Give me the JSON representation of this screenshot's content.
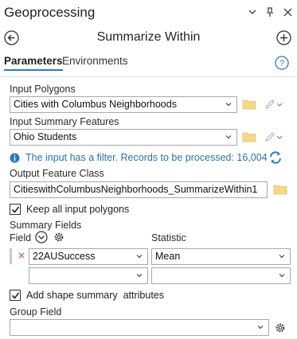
{
  "pane": {
    "title": "Geoprocessing",
    "controls": {
      "options": "⌄",
      "pin": "⊥",
      "close": "✕"
    }
  },
  "tool": {
    "name": "Summarize Within"
  },
  "tabs": [
    {
      "label": "Parameters",
      "active": true
    },
    {
      "label": "Environments",
      "active": false
    }
  ],
  "params": {
    "input_polygons": {
      "label": "Input Polygons",
      "value": "Cities with Columbus Neighborhoods"
    },
    "input_summary": {
      "label": "Input Summary Features",
      "value": "Ohio Students"
    },
    "filter_info": "The input has a filter. Records to be processed: 16,004",
    "output": {
      "label": "Output Feature Class",
      "value": "CitieswithColumbusNeighborhoods_SummarizeWithin1"
    },
    "keep_all": {
      "label": "Keep all input polygons",
      "checked": true
    },
    "summary_fields": {
      "label": "Summary Fields",
      "field_header": "Field",
      "statistic_header": "Statistic",
      "rows": [
        {
          "field": "22AUSuccess",
          "statistic": "Mean"
        },
        {
          "field": "",
          "statistic": ""
        }
      ]
    },
    "add_shape": {
      "label": "Add shape summary  attributes",
      "checked": true
    },
    "group_field": {
      "label": "Group Field",
      "value": ""
    }
  },
  "colors": {
    "accent": "#2b78c5",
    "folder": "#f2c84b",
    "info": "#2b6fb3",
    "remove": "#e06666"
  }
}
